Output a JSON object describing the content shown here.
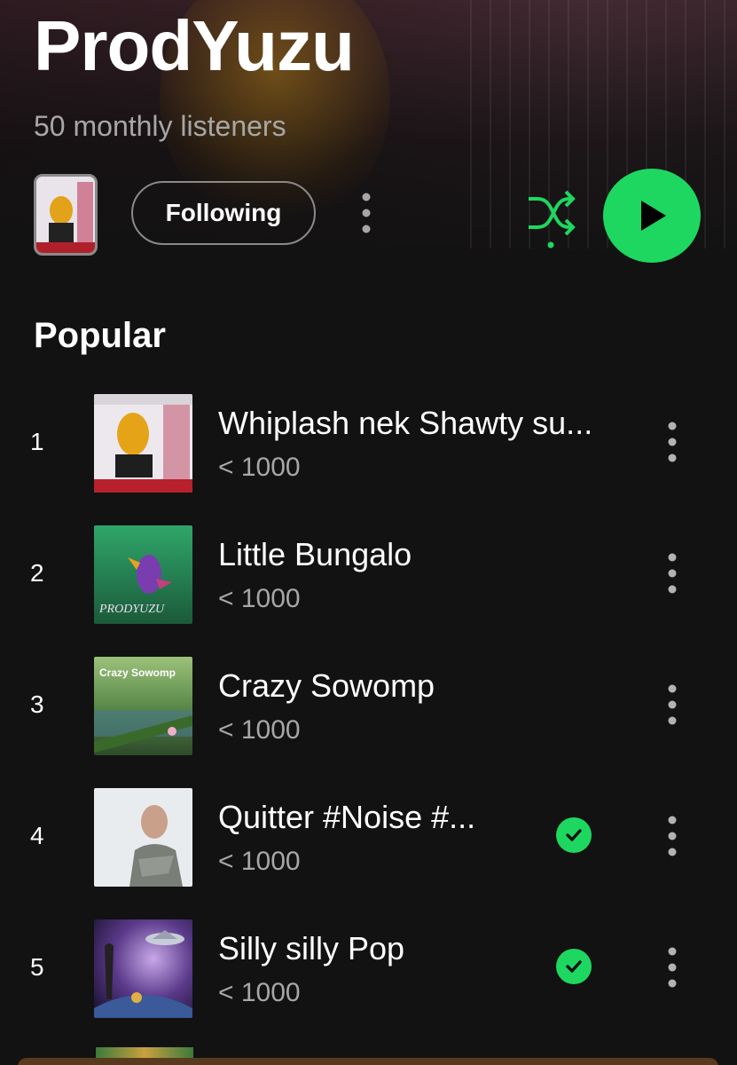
{
  "artist": {
    "name": "ProdYuzu",
    "monthly_listeners": "50 monthly listeners"
  },
  "controls": {
    "follow_label": "Following",
    "more_icon": "more-vertical-icon",
    "shuffle_icon": "shuffle-icon",
    "play_icon": "play-icon",
    "accent_color": "#1ed760"
  },
  "popular": {
    "title": "Popular",
    "tracks": [
      {
        "number": "1",
        "title": "Whiplash nek Shawty su...",
        "plays": "< 1000",
        "saved": false
      },
      {
        "number": "2",
        "title": "Little Bungalo",
        "plays": "< 1000",
        "saved": false
      },
      {
        "number": "3",
        "title": "Crazy Sowomp",
        "plays": "< 1000",
        "saved": false
      },
      {
        "number": "4",
        "title": "Quitter #Noise #...",
        "plays": "< 1000",
        "saved": true
      },
      {
        "number": "5",
        "title": "Silly silly Pop",
        "plays": "< 1000",
        "saved": true
      }
    ]
  },
  "cover_captions": {
    "track2": "PRODYUZU",
    "track3": "Crazy Sowomp"
  }
}
